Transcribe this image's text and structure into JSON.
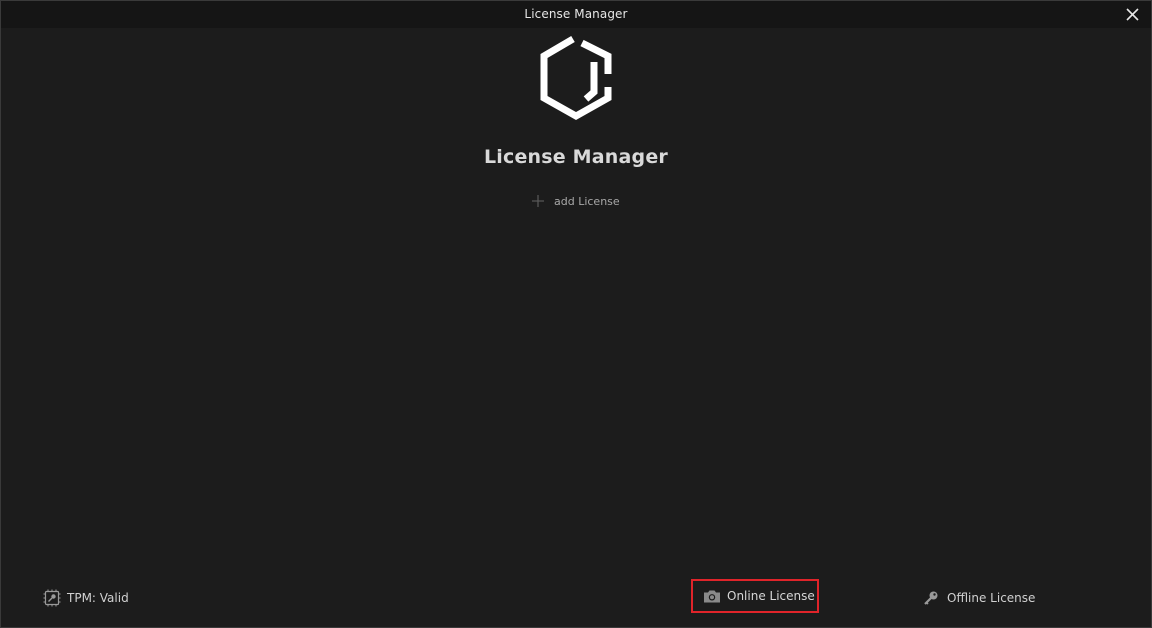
{
  "window": {
    "title": "License Manager"
  },
  "main": {
    "heading": "License Manager",
    "add_license_label": "add License"
  },
  "footer": {
    "tpm_status": "TPM: Valid",
    "online_license_label": "Online License",
    "offline_license_label": "Offline License"
  },
  "icons": {
    "close": "close-icon",
    "logo": "hexagon-logo",
    "add": "plus-icon",
    "tpm": "chip-key-icon",
    "online": "camera-icon",
    "offline": "key-icon"
  },
  "colors": {
    "background": "#1c1c1c",
    "titlebar": "#151515",
    "highlight": "#e0242a",
    "text": "#d8d8d8"
  }
}
